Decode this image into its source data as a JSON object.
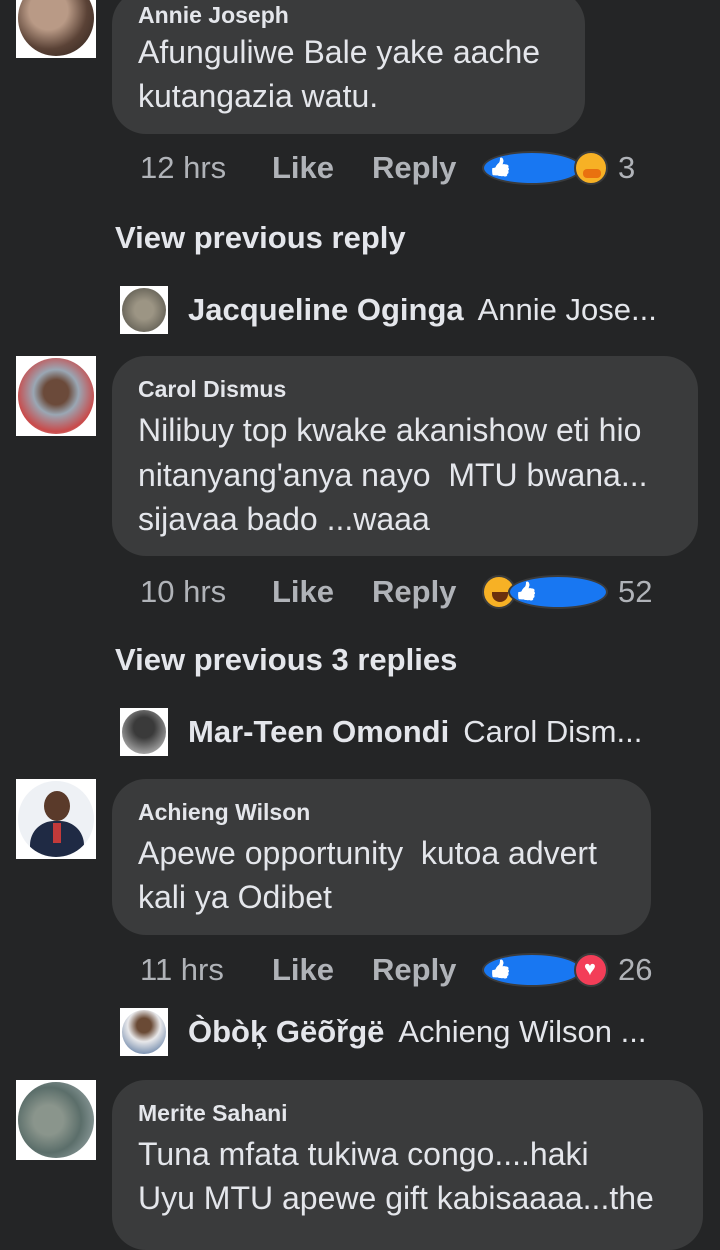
{
  "comments": [
    {
      "author": "Annie Joseph",
      "lines": [
        "Afunguliwe Bale yake aache",
        "kutangazia watu."
      ],
      "time": "12 hrs",
      "like_label": "Like",
      "reply_label": "Reply",
      "reactions": [
        "like",
        "care"
      ],
      "reaction_count": "3",
      "view_previous": "View previous reply",
      "reply_author": "Jacqueline Oginga",
      "reply_preview": "Annie Jose..."
    },
    {
      "author": "Carol Dismus",
      "lines": [
        "Nilibuy top kwake akanishow eti hio",
        "nitanyang'anya nayo  MTU bwana...",
        "sijavaa bado ...waaa"
      ],
      "time": "10 hrs",
      "like_label": "Like",
      "reply_label": "Reply",
      "reactions": [
        "haha",
        "like"
      ],
      "reaction_count": "52",
      "view_previous": "View previous 3 replies",
      "reply_author": "Mar-Teen Omondi",
      "reply_preview": "Carol Dism..."
    },
    {
      "author": "Achieng Wilson",
      "lines": [
        "Apewe opportunity  kutoa advert",
        "kali ya Odibet"
      ],
      "time": "11 hrs",
      "like_label": "Like",
      "reply_label": "Reply",
      "reactions": [
        "like",
        "love"
      ],
      "reaction_count": "26",
      "reply_author": "Òbòķ Gëõřgë",
      "reply_preview": "Achieng Wilson ..."
    },
    {
      "author": "Merite Sahani",
      "lines": [
        "Tuna mfata tukiwa congo....haki",
        "Uyu MTU apewe gift kabisaaaa...the"
      ]
    }
  ],
  "colors": {
    "background": "#242526",
    "bubble": "#3a3b3c",
    "text": "#e4e6eb",
    "meta_text": "#b0b3b8",
    "like_blue": "#1877f2",
    "love_red": "#f33e58",
    "emoji_yellow": "#f7b125"
  }
}
